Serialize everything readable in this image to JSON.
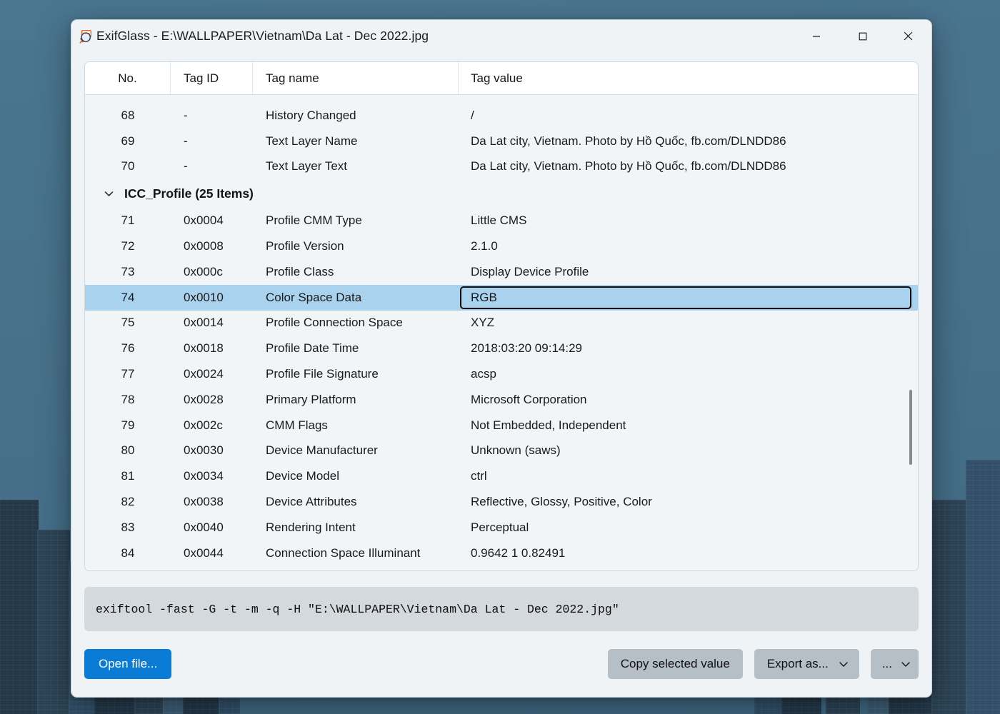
{
  "window": {
    "title": "ExifGlass - E:\\WALLPAPER\\Vietnam\\Da Lat - Dec 2022.jpg",
    "icon": "exifglass-app-icon",
    "controls": {
      "minimize": "─",
      "maximize": "□",
      "close": "✕"
    },
    "accent_color": "#0a7cd6",
    "selection_color": "#a9d2ee",
    "desktop_color": "#47718a"
  },
  "table": {
    "columns": [
      {
        "key": "no",
        "label": "No."
      },
      {
        "key": "tag_id",
        "label": "Tag ID"
      },
      {
        "key": "tag_name",
        "label": "Tag name"
      },
      {
        "key": "tag_value",
        "label": "Tag value"
      }
    ],
    "rows_before_group": [
      {
        "no": "68",
        "tag_id": "-",
        "tag_name": "History Changed",
        "tag_value": "/"
      },
      {
        "no": "69",
        "tag_id": "-",
        "tag_name": "Text Layer Name",
        "tag_value": "Da Lat city, Vietnam. Photo by Hồ Quốc, fb.com/DLNDD86"
      },
      {
        "no": "70",
        "tag_id": "-",
        "tag_name": "Text Layer Text",
        "tag_value": "Da Lat city, Vietnam. Photo by Hồ Quốc, fb.com/DLNDD86"
      }
    ],
    "group": {
      "label": "ICC_Profile (25 Items)",
      "expanded": true,
      "chevron": "chevron-down-icon"
    },
    "rows_in_group": [
      {
        "no": "71",
        "tag_id": "0x0004",
        "tag_name": "Profile CMM Type",
        "tag_value": "Little CMS",
        "selected": false
      },
      {
        "no": "72",
        "tag_id": "0x0008",
        "tag_name": "Profile Version",
        "tag_value": "2.1.0",
        "selected": false
      },
      {
        "no": "73",
        "tag_id": "0x000c",
        "tag_name": "Profile Class",
        "tag_value": "Display Device Profile",
        "selected": false
      },
      {
        "no": "74",
        "tag_id": "0x0010",
        "tag_name": "Color Space Data",
        "tag_value": "RGB",
        "selected": true
      },
      {
        "no": "75",
        "tag_id": "0x0014",
        "tag_name": "Profile Connection Space",
        "tag_value": "XYZ",
        "selected": false
      },
      {
        "no": "76",
        "tag_id": "0x0018",
        "tag_name": "Profile Date Time",
        "tag_value": "2018:03:20 09:14:29",
        "selected": false
      },
      {
        "no": "77",
        "tag_id": "0x0024",
        "tag_name": "Profile File Signature",
        "tag_value": "acsp",
        "selected": false
      },
      {
        "no": "78",
        "tag_id": "0x0028",
        "tag_name": "Primary Platform",
        "tag_value": "Microsoft Corporation",
        "selected": false
      },
      {
        "no": "79",
        "tag_id": "0x002c",
        "tag_name": "CMM Flags",
        "tag_value": "Not Embedded, Independent",
        "selected": false
      },
      {
        "no": "80",
        "tag_id": "0x0030",
        "tag_name": "Device Manufacturer",
        "tag_value": "Unknown (saws)",
        "selected": false
      },
      {
        "no": "81",
        "tag_id": "0x0034",
        "tag_name": "Device Model",
        "tag_value": "ctrl",
        "selected": false
      },
      {
        "no": "82",
        "tag_id": "0x0038",
        "tag_name": "Device Attributes",
        "tag_value": "Reflective, Glossy, Positive, Color",
        "selected": false
      },
      {
        "no": "83",
        "tag_id": "0x0040",
        "tag_name": "Rendering Intent",
        "tag_value": "Perceptual",
        "selected": false
      },
      {
        "no": "84",
        "tag_id": "0x0044",
        "tag_name": "Connection Space Illuminant",
        "tag_value": "0.9642 1 0.82491",
        "selected": false
      }
    ]
  },
  "command": {
    "text": "exiftool -fast -G -t -m -q -H  \"E:\\WALLPAPER\\Vietnam\\Da Lat - Dec 2022.jpg\""
  },
  "footer": {
    "open_file": "Open file...",
    "copy_selected": "Copy selected value",
    "export_as": "Export as...",
    "more": "...",
    "chevron": "chevron-down-icon"
  }
}
